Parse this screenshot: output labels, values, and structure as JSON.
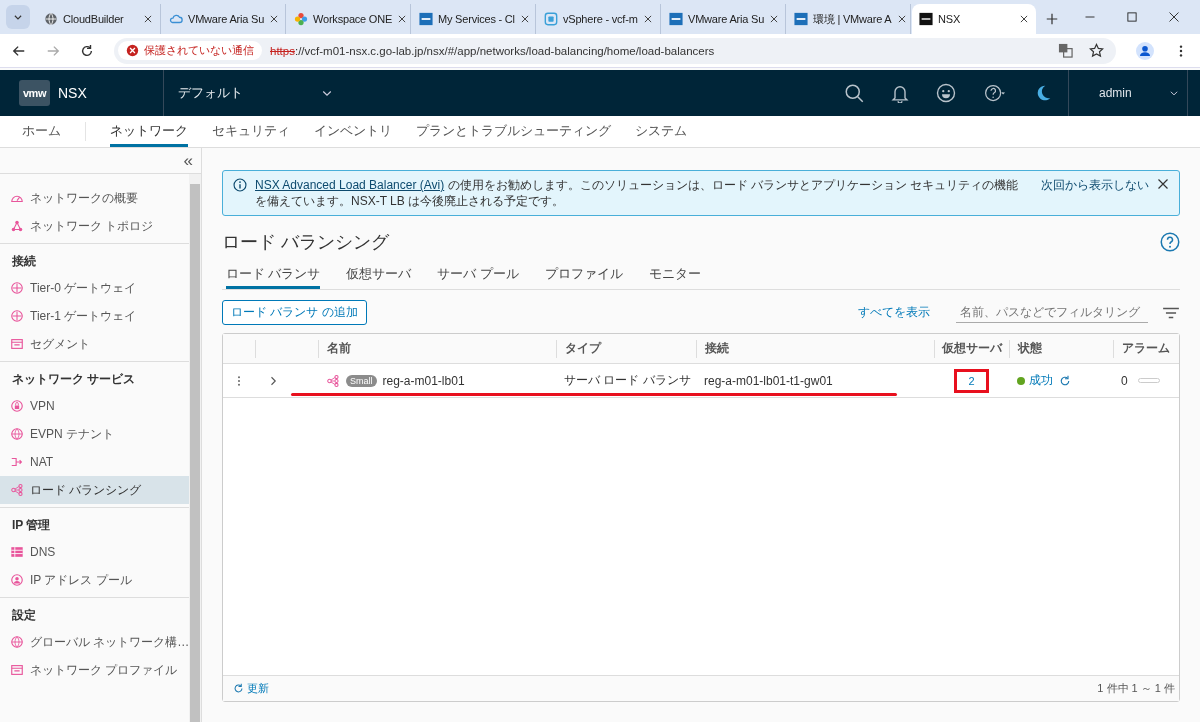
{
  "browser": {
    "tabs": [
      {
        "title": "CloudBuilder",
        "selected": false
      },
      {
        "title": "VMware Aria Su",
        "selected": false
      },
      {
        "title": "Workspace ONE",
        "selected": false
      },
      {
        "title": "My Services - Cl",
        "selected": false
      },
      {
        "title": "vSphere - vcf-m",
        "selected": false
      },
      {
        "title": "VMware Aria Su",
        "selected": false
      },
      {
        "title": "環境 | VMware A",
        "selected": false
      },
      {
        "title": "NSX",
        "selected": true
      }
    ],
    "security": "保護されていない通信",
    "url_scheme": "https",
    "url_rest": "://vcf-m01-nsx.c.go-lab.jp/nsx/#/app/networks/load-balancing/home/load-balancers"
  },
  "header": {
    "logo": "vmw",
    "product": "NSX",
    "project": "デフォルト",
    "user": "admin"
  },
  "nav": [
    {
      "label": "ホーム",
      "selected": false
    },
    {
      "label": "ネットワーク",
      "selected": true
    },
    {
      "label": "セキュリティ",
      "selected": false
    },
    {
      "label": "インベントリ",
      "selected": false
    },
    {
      "label": "プランとトラブルシューティング",
      "selected": false
    },
    {
      "label": "システム",
      "selected": false
    }
  ],
  "sidebar": {
    "collapse": "«",
    "sections": [
      {
        "items": [
          {
            "label": "ネットワークの概要",
            "selected": false
          },
          {
            "label": "ネットワーク トポロジ",
            "selected": false
          }
        ]
      },
      {
        "title": "接続",
        "items": [
          {
            "label": "Tier-0 ゲートウェイ",
            "selected": false
          },
          {
            "label": "Tier-1 ゲートウェイ",
            "selected": false
          },
          {
            "label": "セグメント",
            "selected": false
          }
        ]
      },
      {
        "title": "ネットワーク サービス",
        "items": [
          {
            "label": "VPN",
            "selected": false
          },
          {
            "label": "EVPN テナント",
            "selected": false
          },
          {
            "label": "NAT",
            "selected": false
          },
          {
            "label": "ロード バランシング",
            "selected": true
          }
        ]
      },
      {
        "title": "IP 管理",
        "items": [
          {
            "label": "DNS",
            "selected": false
          },
          {
            "label": "IP アドレス プール",
            "selected": false
          }
        ]
      },
      {
        "title": "設定",
        "items": [
          {
            "label": "グローバル ネットワーク構…",
            "selected": false
          },
          {
            "label": "ネットワーク プロファイル",
            "selected": false
          }
        ]
      }
    ]
  },
  "banner": {
    "link": "NSX Advanced Load Balancer (Avi)",
    "text": " の使用をお勧めします。このソリューションは、ロード バランサとアプリケーション セキュリティの機能を備えています。NSX-T LB は今後廃止される予定です。",
    "dismiss": "次回から表示しない"
  },
  "page": {
    "title": "ロード バランシング"
  },
  "subtabs": [
    {
      "label": "ロード バランサ",
      "selected": true
    },
    {
      "label": "仮想サーバ",
      "selected": false
    },
    {
      "label": "サーバ プール",
      "selected": false
    },
    {
      "label": "プロファイル",
      "selected": false
    },
    {
      "label": "モニター",
      "selected": false
    }
  ],
  "toolbar": {
    "add_button": "ロード バランサ の追加",
    "show_all": "すべてを表示",
    "filter_placeholder": "名前、パスなどでフィルタリング"
  },
  "table": {
    "columns": [
      "名前",
      "タイプ",
      "接続",
      "仮想サーバ",
      "状態",
      "アラーム"
    ],
    "rows": [
      {
        "size": "Small",
        "name": "reg-a-m01-lb01",
        "type": "サーバ ロード バランサ",
        "connection": "reg-a-m01-lb01-t1-gw01",
        "virtual_servers": "2",
        "status": "成功",
        "color": "#62a420",
        "alarms": "0",
        "underlined": true,
        "highlighted": true
      }
    ],
    "refresh": "更新",
    "count": "1 件中 1 ～ 1 件"
  }
}
